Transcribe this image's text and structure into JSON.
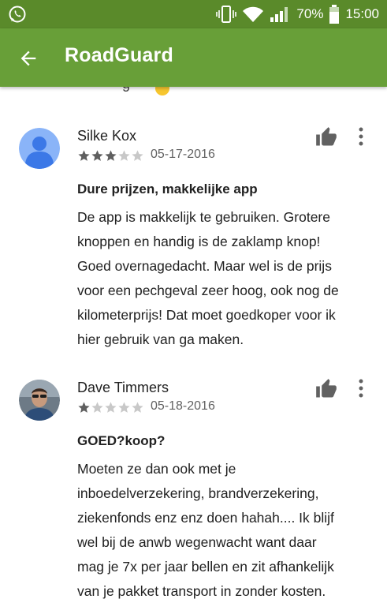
{
  "status_bar": {
    "battery_percent": "70%",
    "time": "15:00",
    "icons": [
      "whatsapp-icon",
      "vibrate-icon",
      "wifi-icon",
      "signal-icon",
      "battery-icon"
    ]
  },
  "app_bar": {
    "title": "RoadGuard",
    "back_icon": "arrow-back-icon",
    "color": "#689f38"
  },
  "reviews": [
    {
      "author": "Silke Kox",
      "rating": 3,
      "max_rating": 5,
      "date": "05-17-2016",
      "title": "Dure prijzen, makkelijke app",
      "body_lines": [
        "De app is makkelijk te gebruiken. Grotere",
        "knoppen en handig is de zaklamp knop!",
        "Goed overnagedacht. Maar wel is de prijs",
        "voor een pechgeval zeer hoog, ook nog de",
        "kilometerprijs! Dat moet goedkoper voor ik",
        "hier gebruik van ga maken."
      ],
      "avatar": "default-person-avatar"
    },
    {
      "author": "Dave Timmers",
      "rating": 1,
      "max_rating": 5,
      "date": "05-18-2016",
      "title": "GOED?koop?",
      "body_lines": [
        "Moeten ze dan ook met je",
        "inboedelverzekering, brandverzekering,",
        "ziekenfonds enz enz doen hahah.... Ik blijf",
        "wel bij de anwb wegenwacht want daar",
        "mag je 7x per jaar bellen en zit afhankelijk",
        "van je pakket transport in zonder kosten."
      ],
      "avatar": "photo-avatar"
    }
  ],
  "star_colors": {
    "filled": "#5f5f5f",
    "empty": "#c8c8c8"
  }
}
